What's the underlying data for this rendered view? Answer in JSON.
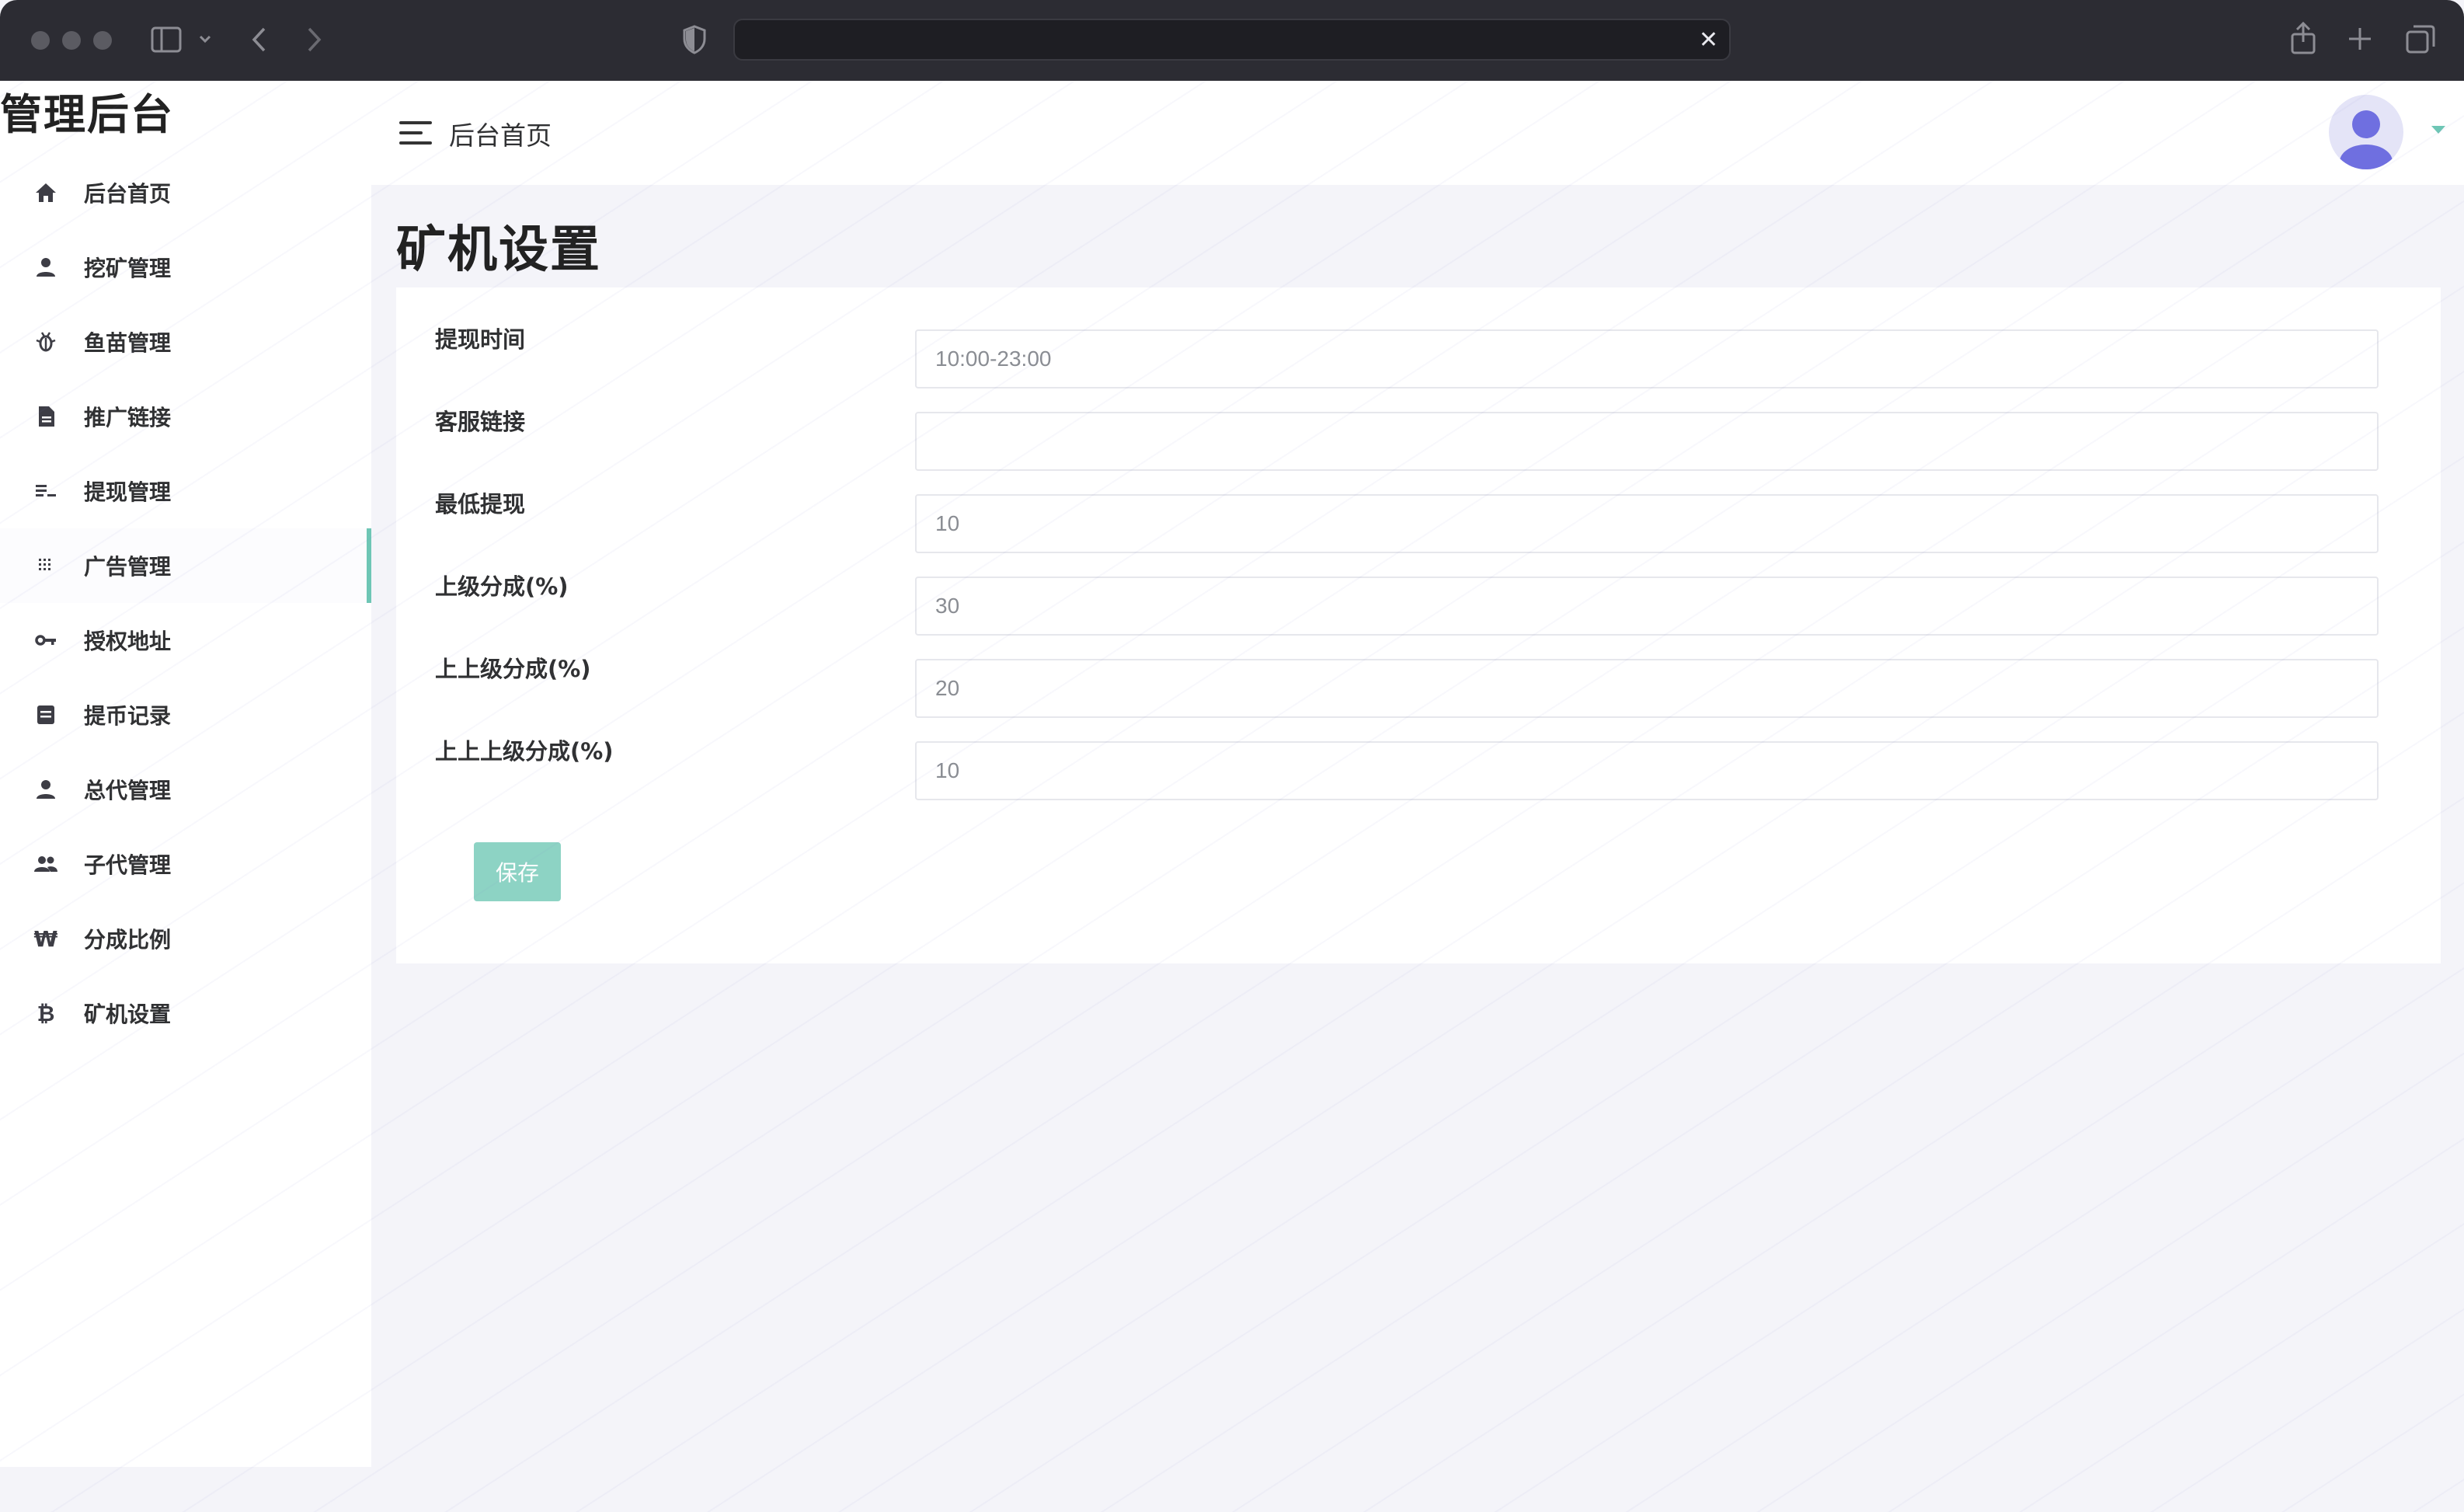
{
  "header": {
    "title": "后台首页"
  },
  "sidebar": {
    "brand": "管理后台",
    "items": [
      {
        "label": "后台首页",
        "icon": "home-icon"
      },
      {
        "label": "挖矿管理",
        "icon": "user-icon"
      },
      {
        "label": "鱼苗管理",
        "icon": "bug-icon"
      },
      {
        "label": "推广链接",
        "icon": "document-icon"
      },
      {
        "label": "提现管理",
        "icon": "list-icon"
      },
      {
        "label": "广告管理",
        "icon": "grid-icon",
        "active": true
      },
      {
        "label": "授权地址",
        "icon": "key-icon"
      },
      {
        "label": "提币记录",
        "icon": "note-icon"
      },
      {
        "label": "总代管理",
        "icon": "user-icon"
      },
      {
        "label": "子代管理",
        "icon": "group-icon"
      },
      {
        "label": "分成比例",
        "icon": "won-icon"
      },
      {
        "label": "矿机设置",
        "icon": "bitcoin-icon"
      }
    ]
  },
  "main": {
    "page_title": "矿机设置",
    "fields": [
      {
        "label": "提现时间",
        "value": "10:00-23:00"
      },
      {
        "label": "客服链接",
        "value": ""
      },
      {
        "label": "最低提现",
        "value": "10"
      },
      {
        "label": "上级分成(%)",
        "value": "30"
      },
      {
        "label": "上上级分成(%)",
        "value": "20"
      },
      {
        "label": "上上上级分成(%)",
        "value": "10"
      }
    ],
    "save_label": "保存"
  },
  "colors": {
    "accent": "#6ec6b5",
    "button": "#8dd3c4",
    "background": "#f4f4f9",
    "chrome": "#2c2c33"
  }
}
